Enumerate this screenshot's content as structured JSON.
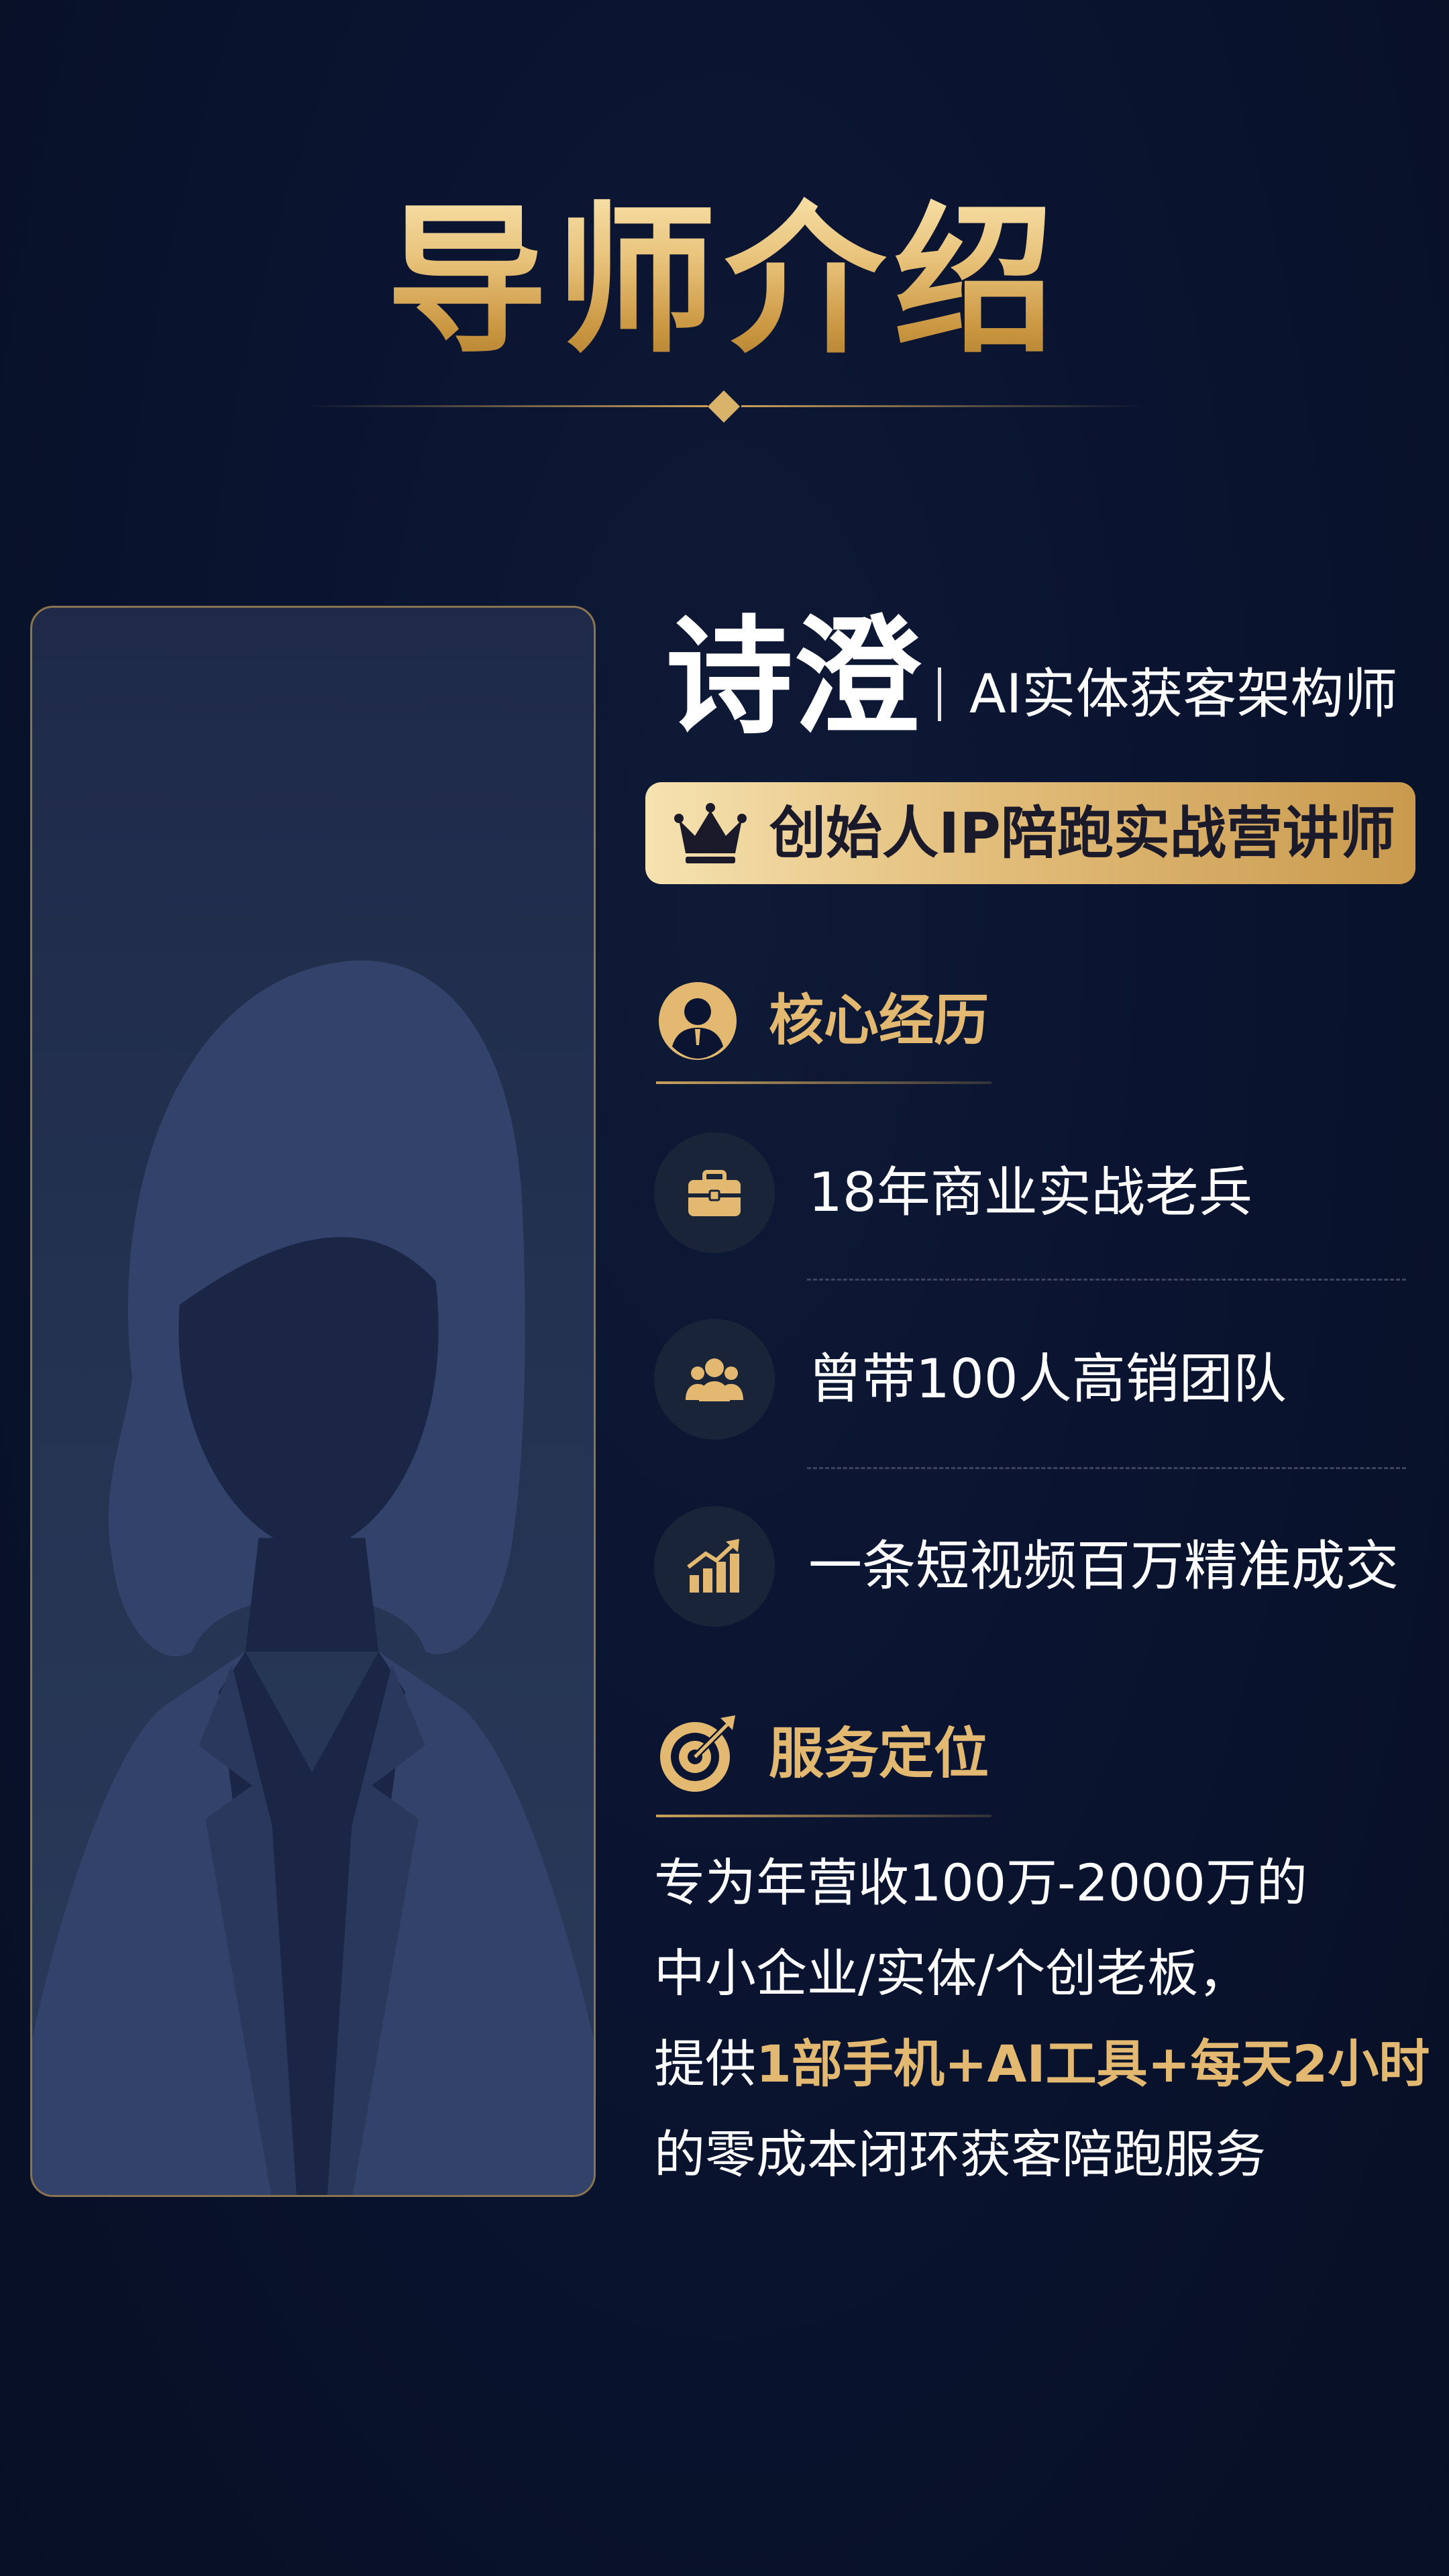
{
  "header": {
    "title": "导师介绍"
  },
  "profile": {
    "name": "诗澄",
    "role": "AI实体获客架构师",
    "badge": "创始人IP陪跑实战营讲师"
  },
  "experience": {
    "heading": "核心经历",
    "heading_icon": "user-avatar-icon",
    "items": [
      {
        "icon": "briefcase-icon",
        "text": "18年商业实战老兵"
      },
      {
        "icon": "team-icon",
        "text": "曾带100人高销团队"
      },
      {
        "icon": "growth-chart-icon",
        "text": "一条短视频百万精准成交"
      }
    ]
  },
  "service": {
    "heading": "服务定位",
    "heading_icon": "target-icon",
    "line1": "专为年营收100万-2000万的",
    "line2": "中小企业/实体/个创老板，",
    "line3_prefix": "提供",
    "line3_highlight": "1部手机+AI工具+每天2小时",
    "line4": "的零成本闭环获客陪跑服务"
  },
  "colors": {
    "background": "#0a1430",
    "gold": "#e3b972",
    "card_border": "#8a7350"
  }
}
